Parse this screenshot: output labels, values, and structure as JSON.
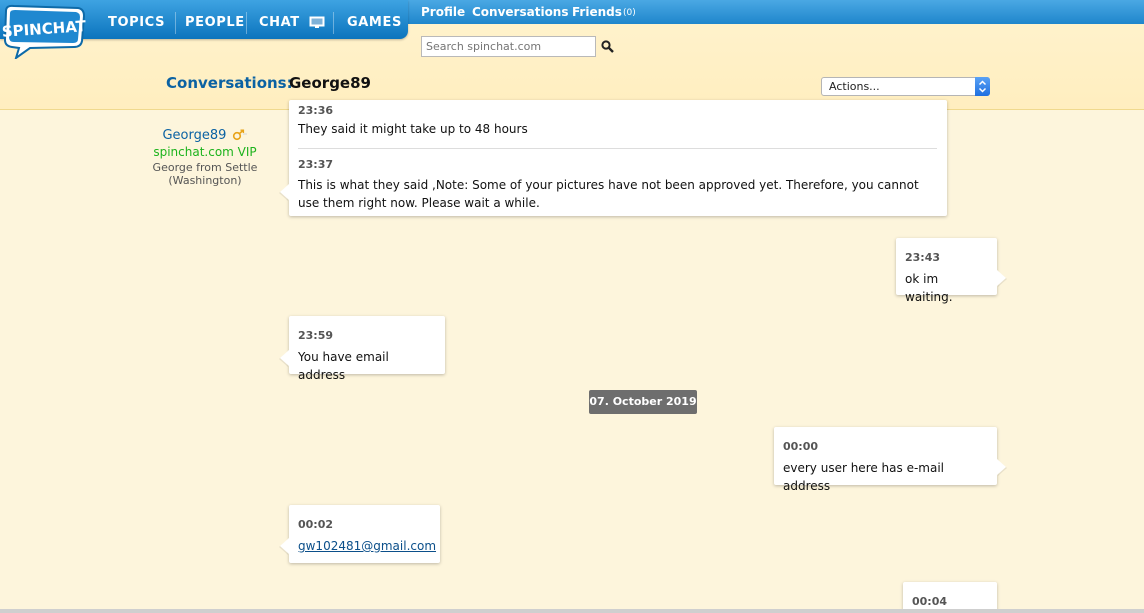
{
  "nav": {
    "logo_text": "SPINCHAT",
    "topics": "TOPICS",
    "people": "PEOPLE",
    "chat": "CHAT",
    "games": "GAMES"
  },
  "subnav": {
    "profile": "Profile",
    "conversations": "Conversations",
    "friends": "Friends",
    "friends_count": "(0)"
  },
  "search": {
    "placeholder": "Search spinchat.com"
  },
  "header": {
    "conversations_label": "Conversations:",
    "partner_name": "George89",
    "actions_label": "Actions..."
  },
  "profile": {
    "username": "George89",
    "vip": "spinchat.com VIP",
    "location_line1": "George from Settle",
    "location_line2": "(Washington)"
  },
  "messages": [
    {
      "side": "left",
      "time": "23:36",
      "text": "They said it might take up to 48 hours"
    },
    {
      "side": "left",
      "time": "23:37",
      "text": "This is what they said ,Note: Some of your pictures have not been approved yet. Therefore, you cannot use them right now. Please wait a while."
    },
    {
      "side": "right",
      "time": "23:43",
      "text": "ok im waiting."
    },
    {
      "side": "left",
      "time": "23:59",
      "text": "You have email address"
    },
    {
      "side": "right",
      "time": "00:00",
      "text": "every user here has e-mail address"
    },
    {
      "side": "left",
      "time": "00:02",
      "text": "gw102481@gmail.com"
    },
    {
      "side": "right",
      "time": "00:04",
      "text": ""
    }
  ],
  "date_separator": "07. October 2019",
  "colors": {
    "background": "#fdf5dc",
    "nav_blue": "#0b74bd",
    "link_blue": "#0b62a3",
    "vip_green": "#1db31d"
  }
}
